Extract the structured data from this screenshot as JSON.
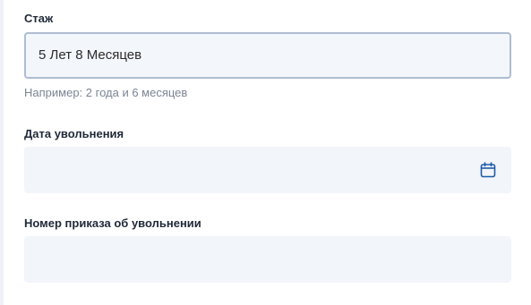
{
  "form": {
    "experience": {
      "label": "Стаж",
      "value": "5 Лет 8 Месяцев",
      "hint": "Например: 2 года и 6 месяцев"
    },
    "dismissal_date": {
      "label": "Дата увольнения",
      "value": "",
      "icon": "calendar-icon"
    },
    "dismissal_order_number": {
      "label": "Номер приказа об увольнении",
      "value": ""
    }
  },
  "colors": {
    "field_bg": "#f2f5f9",
    "active_border": "#aebdd1",
    "icon_blue": "#1e5aa8",
    "label_text": "#1f2937",
    "hint_text": "#7b8593"
  }
}
